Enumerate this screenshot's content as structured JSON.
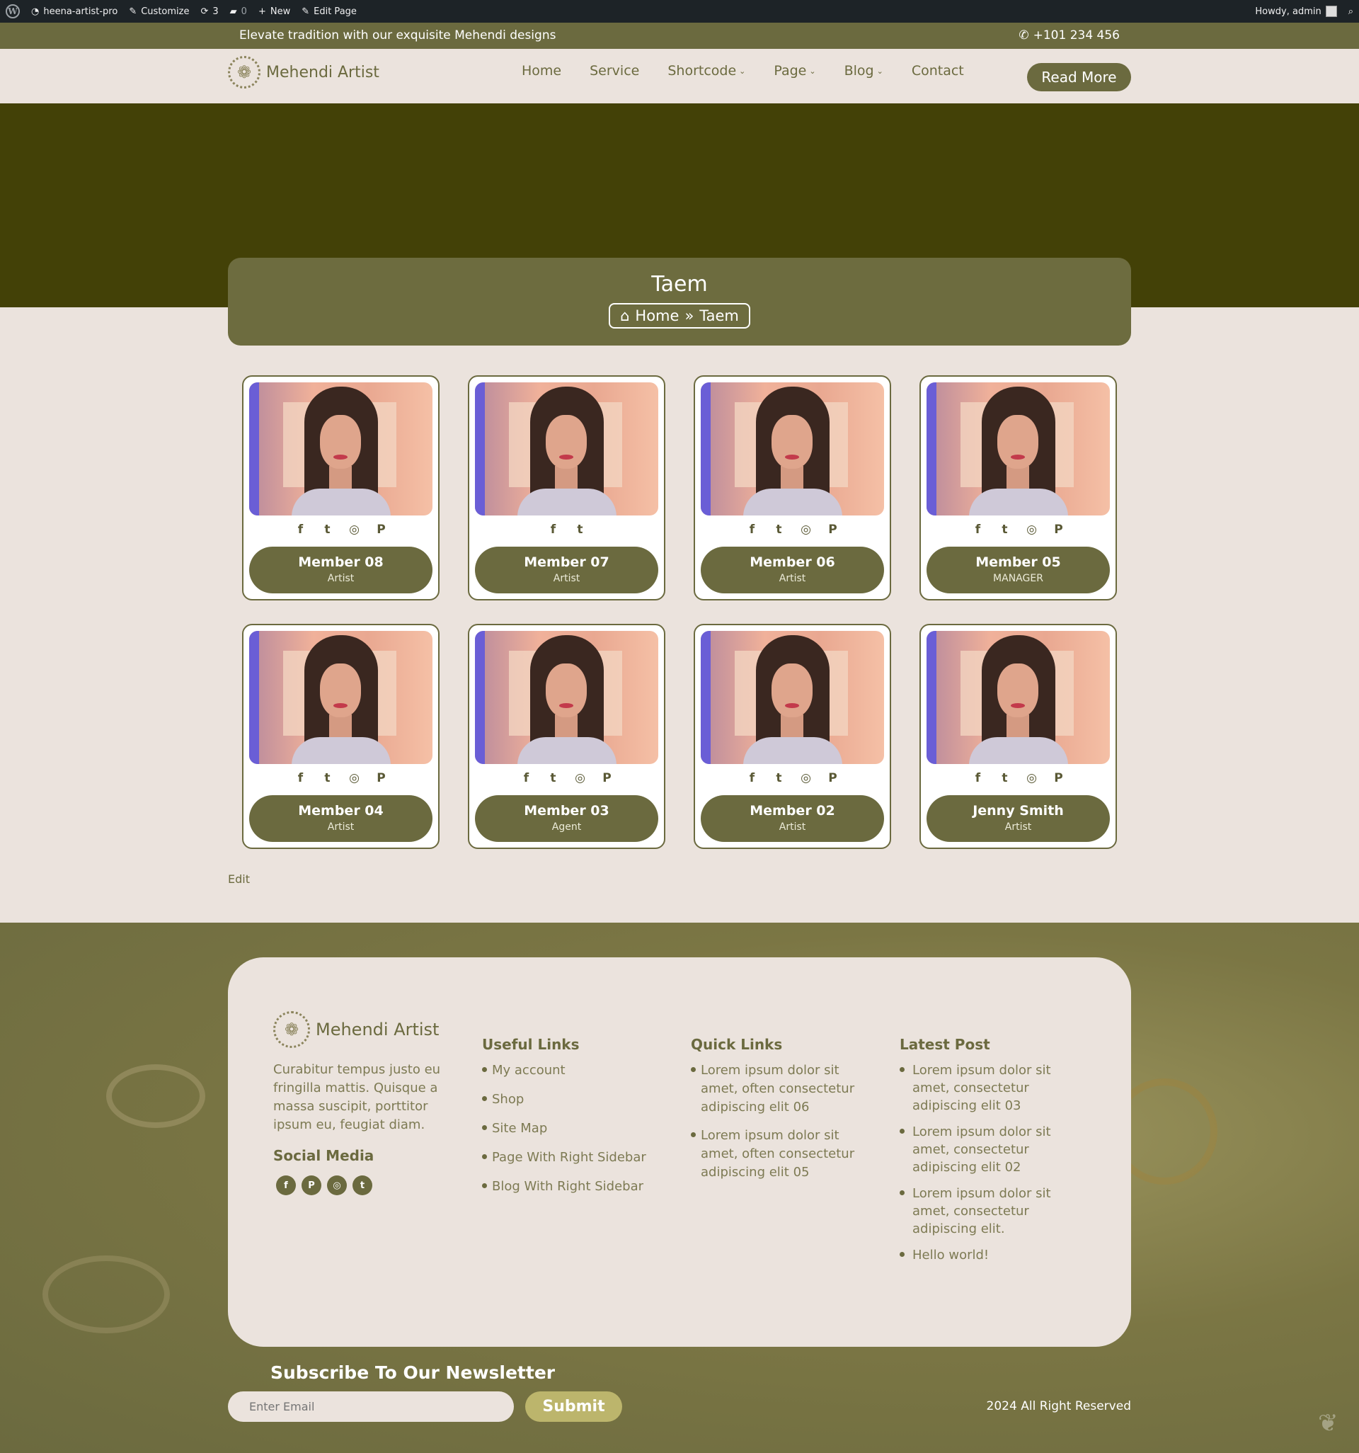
{
  "adminbar": {
    "site_name": "heena-artist-pro",
    "customize": "Customize",
    "updates": "3",
    "comments": "0",
    "new": "New",
    "edit_page": "Edit Page",
    "howdy": "Howdy, admin"
  },
  "topstrip": {
    "tagline": "Elevate tradition with our exquisite Mehendi designs",
    "phone": "+101 234 456"
  },
  "header": {
    "logo_text": "Mehendi Artist",
    "nav": [
      {
        "label": "Home"
      },
      {
        "label": "Service"
      },
      {
        "label": "Shortcode",
        "has_dropdown": true
      },
      {
        "label": "Page",
        "has_dropdown": true
      },
      {
        "label": "Blog",
        "has_dropdown": true
      },
      {
        "label": "Contact"
      }
    ],
    "cta": "Read More"
  },
  "page_title": {
    "title": "Taem",
    "breadcrumb_home": "Home",
    "breadcrumb_current": "Taem"
  },
  "team": [
    {
      "name": "Member 08",
      "role": "Artist",
      "socials": [
        "facebook",
        "twitter",
        "instagram",
        "pinterest"
      ]
    },
    {
      "name": "Member 07",
      "role": "Artist",
      "socials": [
        "facebook",
        "twitter"
      ]
    },
    {
      "name": "Member 06",
      "role": "Artist",
      "socials": [
        "facebook",
        "twitter",
        "instagram",
        "pinterest"
      ]
    },
    {
      "name": "Member 05",
      "role": "MANAGER",
      "socials": [
        "facebook",
        "twitter",
        "instagram",
        "pinterest"
      ]
    },
    {
      "name": "Member 04",
      "role": "Artist",
      "socials": [
        "facebook",
        "twitter",
        "instagram",
        "pinterest"
      ]
    },
    {
      "name": "Member 03",
      "role": "Agent",
      "socials": [
        "facebook",
        "twitter",
        "instagram",
        "pinterest"
      ]
    },
    {
      "name": "Member 02",
      "role": "Artist",
      "socials": [
        "facebook",
        "twitter",
        "instagram",
        "pinterest"
      ]
    },
    {
      "name": "Jenny Smith",
      "role": "Artist",
      "socials": [
        "facebook",
        "twitter",
        "instagram",
        "pinterest"
      ]
    }
  ],
  "edit_link": "Edit",
  "footer": {
    "logo_text": "Mehendi Artist",
    "description": "Curabitur tempus justo eu fringilla mattis. Quisque a massa suscipit, porttitor ipsum eu, feugiat diam.",
    "social_heading": "Social Media",
    "useful_links": {
      "heading": "Useful Links",
      "items": [
        "My account",
        "Shop",
        "Site Map",
        "Page With Right Sidebar",
        "Blog With Right Sidebar"
      ]
    },
    "quick_links": {
      "heading": "Quick Links",
      "items": [
        "Lorem ipsum dolor sit amet, often consectetur adipiscing elit 06",
        "Lorem ipsum dolor sit amet, often consectetur adipiscing elit 05"
      ]
    },
    "latest_post": {
      "heading": "Latest Post",
      "items": [
        "Lorem ipsum dolor sit amet, consectetur adipiscing elit 03",
        "Lorem ipsum dolor sit amet, consectetur adipiscing elit 02",
        "Lorem ipsum dolor sit amet, consectetur adipiscing elit.",
        "Hello world!"
      ]
    },
    "newsletter_heading": "Subscribe To Our Newsletter",
    "email_placeholder": "Enter Email",
    "submit": "Submit",
    "copyright": "2024 All Right Reserved"
  },
  "colors": {
    "primary": "#6b6a3f",
    "hero": "#434107",
    "background": "#ebe3dd",
    "accent": "#bcb56c"
  }
}
